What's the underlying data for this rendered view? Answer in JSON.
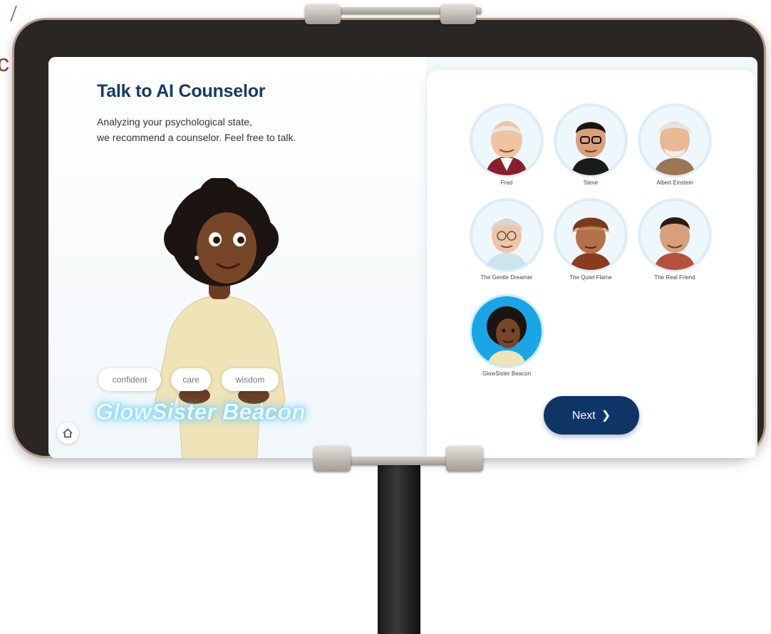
{
  "backdrop": {
    "edge_text": "c"
  },
  "header": {
    "title": "Talk to AI Counselor",
    "subtitle_line1": "Analyzing your psychological state,",
    "subtitle_line2": "we recommend a counselor. Feel free to talk."
  },
  "featured": {
    "name": "GlowSister Beacon",
    "traits": [
      "confident",
      "care",
      "wisdom"
    ]
  },
  "counselors": [
    {
      "name": "Fred",
      "selected": false
    },
    {
      "name": "Steve",
      "selected": false
    },
    {
      "name": "Albert Einstein",
      "selected": false
    },
    {
      "name": "The Gentle Dreamer",
      "selected": false
    },
    {
      "name": "The Quiet Flame",
      "selected": false
    },
    {
      "name": "The Real Friend",
      "selected": false
    },
    {
      "name": "GlowSister Beacon",
      "selected": true
    }
  ],
  "actions": {
    "next_label": "Next"
  },
  "icons": {
    "home": "home-icon",
    "next": "chevron-right-icon"
  },
  "colors": {
    "title": "#143a6b",
    "accent": "#1aa5e6",
    "button": "#0f3566",
    "glow": "#4ac6ff"
  }
}
